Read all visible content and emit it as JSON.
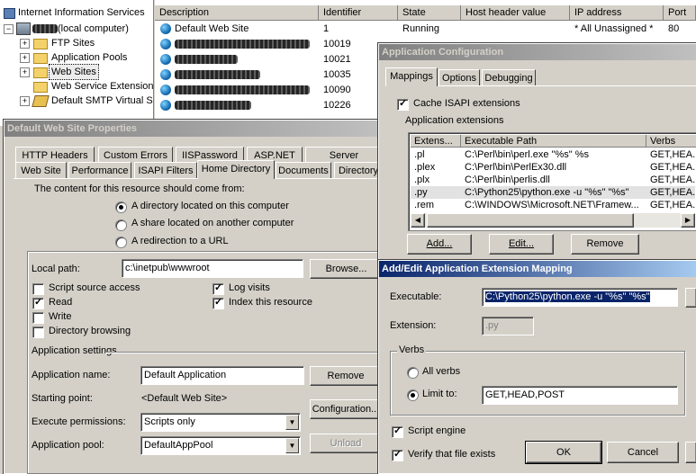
{
  "tree": {
    "root_label": "Internet Information Services",
    "computer_label": "(local computer)",
    "items": [
      "FTP Sites",
      "Application Pools",
      "Web Sites",
      "Web Service Extensions",
      "Default SMTP Virtual Server"
    ]
  },
  "list": {
    "columns": [
      "Description",
      "Identifier",
      "State",
      "Host header value",
      "IP address",
      "Port"
    ],
    "rows": [
      {
        "description": "Default Web Site",
        "identifier": "1",
        "state": "Running",
        "host": "",
        "ip": "* All Unassigned *",
        "port": "80"
      },
      {
        "description": "",
        "identifier": "10019"
      },
      {
        "description": "",
        "identifier": "10021"
      },
      {
        "description": "",
        "identifier": "10035"
      },
      {
        "description": "",
        "identifier": "10090"
      },
      {
        "description": "",
        "identifier": "10226"
      }
    ]
  },
  "props": {
    "title": "Default Web Site Properties",
    "tabs_row1": [
      "HTTP Headers",
      "Custom Errors",
      "IISPassword",
      "ASP.NET",
      "Server Extensions"
    ],
    "tabs_row2": [
      "Web Site",
      "Performance",
      "ISAPI Filters",
      "Home Directory",
      "Documents",
      "Directory Security"
    ],
    "content_prompt": "The content for this resource should come from:",
    "radio_directory": "A directory located on this computer",
    "radio_share": "A share located on another computer",
    "radio_redirect": "A redirection to a URL",
    "local_path_label": "Local path:",
    "local_path_value": "c:\\inetpub\\wwwroot",
    "browse": "Browse...",
    "chk_script_source": "Script source access",
    "chk_read": "Read",
    "chk_write": "Write",
    "chk_dir_browsing": "Directory browsing",
    "chk_log_visits": "Log visits",
    "chk_index": "Index this resource",
    "app_settings": "Application settings",
    "app_name_label": "Application name:",
    "app_name_value": "Default Application",
    "remove": "Remove",
    "starting_point_label": "Starting point:",
    "starting_point_value": "<Default Web Site>",
    "configuration": "Configuration...",
    "exec_perm_label": "Execute permissions:",
    "exec_perm_value": "Scripts only",
    "app_pool_label": "Application pool:",
    "app_pool_value": "DefaultAppPool",
    "unload": "Unload"
  },
  "appconfig": {
    "title": "Application Configuration",
    "tabs": [
      "Mappings",
      "Options",
      "Debugging"
    ],
    "cache_isapi": "Cache ISAPI extensions",
    "app_extensions": "Application extensions",
    "columns": [
      "Extens...",
      "Executable Path",
      "Verbs"
    ],
    "rows": [
      {
        "ext": ".pl",
        "path": "C:\\Perl\\bin\\perl.exe \"%s\" %s",
        "verbs": "GET,HEA..."
      },
      {
        "ext": ".plex",
        "path": "C:\\Perl\\bin\\PerlEx30.dll",
        "verbs": "GET,HEA..."
      },
      {
        "ext": ".plx",
        "path": "C:\\Perl\\bin\\perlis.dll",
        "verbs": "GET,HEA..."
      },
      {
        "ext": ".py",
        "path": "C:\\Python25\\python.exe -u \"%s\" \"%s\"",
        "verbs": "GET,HEA..."
      },
      {
        "ext": ".rem",
        "path": "C:\\WINDOWS\\Microsoft.NET\\Framew...",
        "verbs": "GET,HEA..."
      }
    ],
    "add": "Add...",
    "edit": "Edit...",
    "remove": "Remove"
  },
  "mapping": {
    "title": "Add/Edit Application Extension Mapping",
    "executable_label": "Executable:",
    "executable_value": "C:\\Python25\\python.exe -u \"%s\" \"%s\"",
    "extension_label": "Extension:",
    "extension_value": ".py",
    "verbs_group": "Verbs",
    "all_verbs": "All verbs",
    "limit_to": "Limit to:",
    "limit_value": "GET,HEAD,POST",
    "script_engine": "Script engine",
    "verify_file": "Verify that file exists",
    "ok": "OK",
    "cancel": "Cancel"
  }
}
